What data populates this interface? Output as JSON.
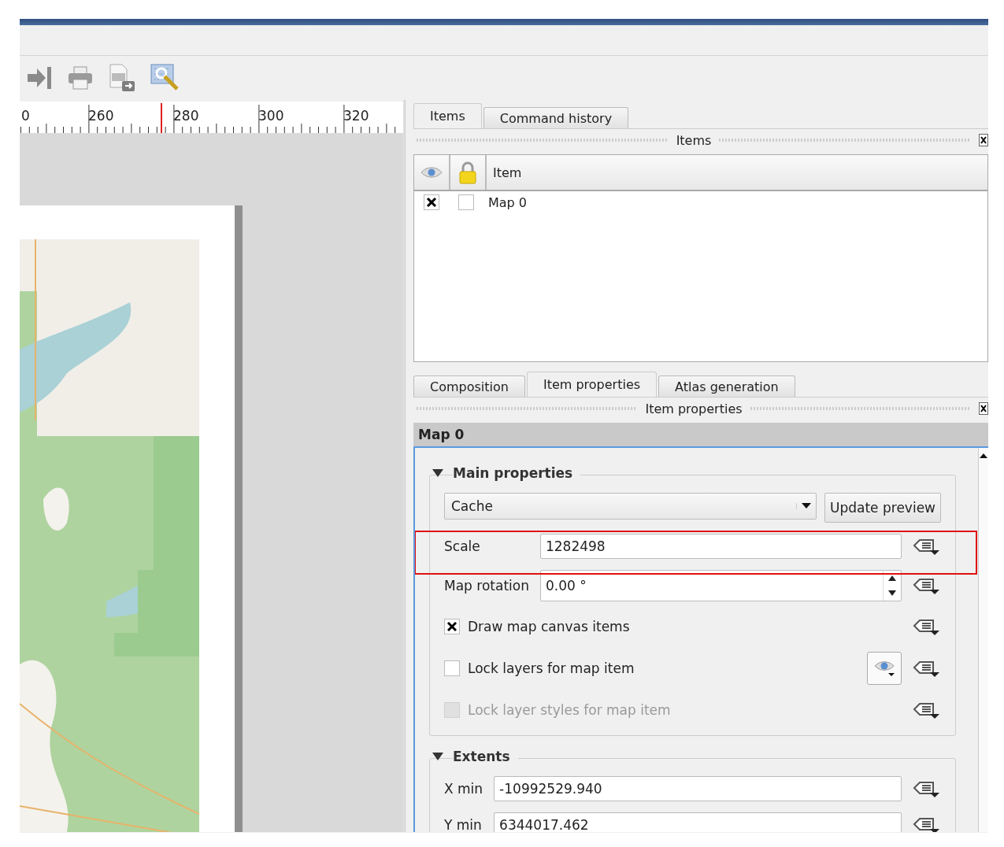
{
  "ruler": {
    "labels": [
      "0",
      "260",
      "280",
      "300",
      "320"
    ]
  },
  "items_dock": {
    "tabs": [
      {
        "label": "Items",
        "selected": true
      },
      {
        "label": "Command history",
        "selected": false
      }
    ],
    "title": "Items",
    "table": {
      "columns": [
        "Item"
      ],
      "rows": [
        {
          "visible": true,
          "locked": false,
          "name": "Map 0"
        }
      ]
    }
  },
  "properties_dock": {
    "tabs": [
      {
        "label": "Composition",
        "selected": false
      },
      {
        "label": "Item properties",
        "selected": true
      },
      {
        "label": "Atlas generation",
        "selected": false
      }
    ],
    "title": "Item properties",
    "item_title": "Map 0",
    "groups": [
      {
        "title": "Main properties",
        "expanded": true,
        "rows": [
          {
            "kind": "combo",
            "value": "Cache",
            "button": "Update preview"
          },
          {
            "kind": "field",
            "label": "Scale",
            "value": "1282498",
            "highlighted": true
          },
          {
            "kind": "spin",
            "label": "Map rotation",
            "value": "0.00 °"
          },
          {
            "kind": "checkbox",
            "label": "Draw map canvas items",
            "checked": true,
            "disabled": false,
            "layer_menu": false
          },
          {
            "kind": "checkbox",
            "label": "Lock layers for map item",
            "checked": false,
            "disabled": false,
            "layer_menu": true
          },
          {
            "kind": "checkbox",
            "label": "Lock layer styles for map item",
            "checked": false,
            "disabled": true,
            "layer_menu": false
          }
        ]
      },
      {
        "title": "Extents",
        "expanded": true,
        "rows": [
          {
            "kind": "field",
            "label": "X min",
            "value": "-10992529.940"
          },
          {
            "kind": "field",
            "label": "Y min",
            "value": "6344017.462"
          }
        ]
      }
    ]
  }
}
